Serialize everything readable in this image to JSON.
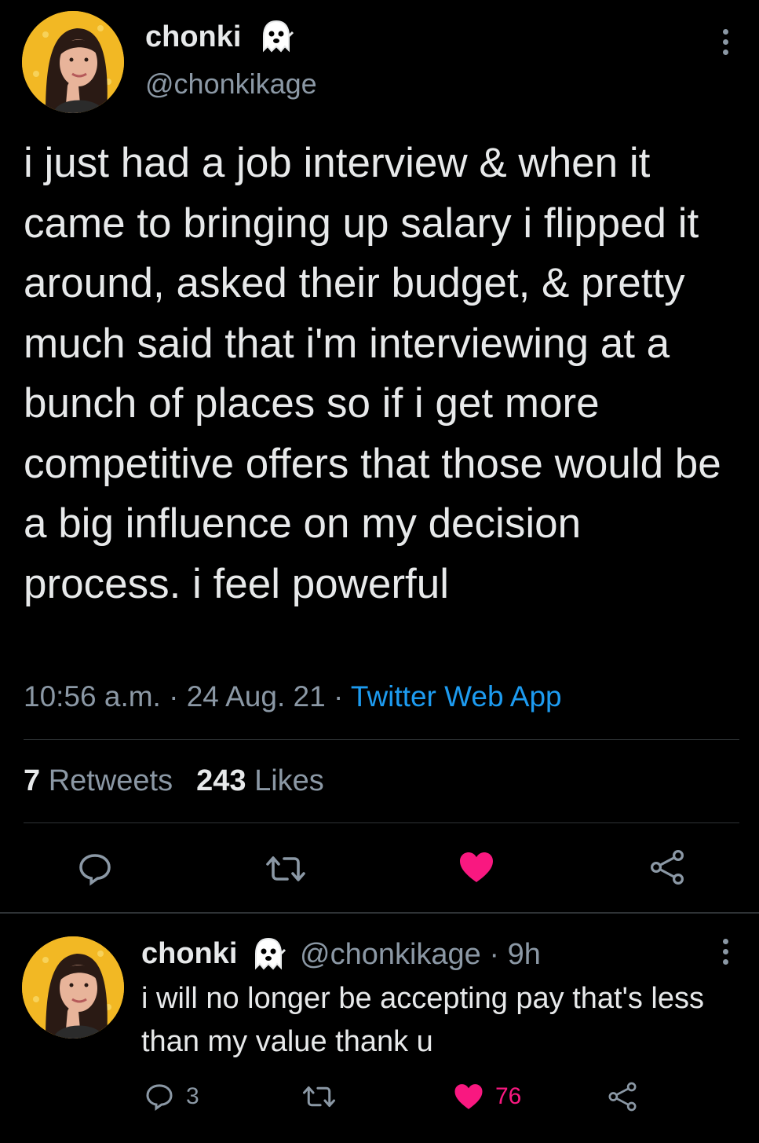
{
  "main_tweet": {
    "author_name": "chonki",
    "author_handle": "@chonkikage",
    "text": "i just had a job interview & when it came to bringing up salary i flipped it around, asked their budget, & pretty much said that i'm interviewing at a bunch of places so if i get more competitive offers that those would be a big influence on my decision process. i feel powerful",
    "time": "10:56 a.m.",
    "date": "24 Aug. 21",
    "source": "Twitter Web App",
    "retweet_count": "7",
    "retweet_label": "Retweets",
    "like_count": "243",
    "like_label": "Likes"
  },
  "reply_tweet": {
    "author_name": "chonki",
    "author_handle": "@chonkikage",
    "age": "9h",
    "text": "i will no longer be accepting pay that's less than my value thank u",
    "reply_count": "3",
    "like_count": "76"
  },
  "icons": {
    "badge": "ghost-icon",
    "reply": "reply-icon",
    "retweet": "retweet-icon",
    "like": "heart-icon",
    "share": "share-icon",
    "more": "more-vertical-icon"
  },
  "colors": {
    "background": "#000000",
    "text": "#e7e9ea",
    "secondary": "#8b98a5",
    "link": "#1d9bf0",
    "like": "#f91880",
    "avatar_bg": "#f2b824"
  }
}
